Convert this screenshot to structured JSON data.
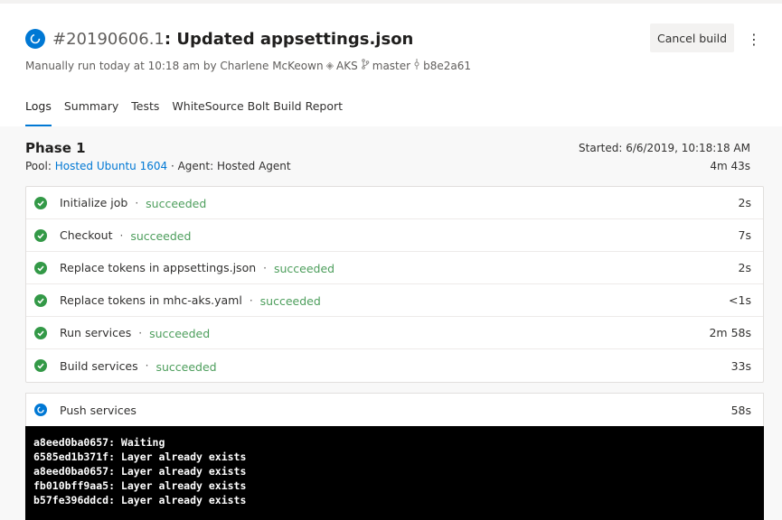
{
  "run": {
    "number": "#20190606.1",
    "title": "Updated appsettings.json",
    "trigger": "Manually run today at 10:18 am by Charlene McKeown",
    "repo": "AKS",
    "branch": "master",
    "commit": "b8e2a61"
  },
  "actions": {
    "cancel_label": "Cancel build",
    "more_label": "⋮"
  },
  "tabs": [
    {
      "label": "Logs",
      "active": true
    },
    {
      "label": "Summary",
      "active": false
    },
    {
      "label": "Tests",
      "active": false
    },
    {
      "label": "WhiteSource Bolt Build Report",
      "active": false
    }
  ],
  "phase": {
    "title": "Phase 1",
    "pool_label": "Pool:",
    "pool": "Hosted Ubuntu 1604",
    "agent_label": "· Agent: Hosted Agent",
    "started": "Started: 6/6/2019, 10:18:18 AM",
    "duration": "4m 43s"
  },
  "steps": [
    {
      "name": "Initialize job",
      "status": "succeeded",
      "time": "2s"
    },
    {
      "name": "Checkout",
      "status": "succeeded",
      "time": "7s"
    },
    {
      "name": "Replace tokens in appsettings.json",
      "status": "succeeded",
      "time": "2s"
    },
    {
      "name": "Replace tokens in mhc-aks.yaml",
      "status": "succeeded",
      "time": "<1s"
    },
    {
      "name": "Run services",
      "status": "succeeded",
      "time": "2m 58s"
    },
    {
      "name": "Build services",
      "status": "succeeded",
      "time": "33s"
    }
  ],
  "running_step": {
    "name": "Push services",
    "time": "58s"
  },
  "console": [
    "a8eed0ba0657: Waiting",
    "6585ed1b371f: Layer already exists",
    "a8eed0ba0657: Layer already exists",
    "fb010bff9aa5: Layer already exists",
    "b57fe396ddcd: Layer already exists"
  ],
  "icons": {
    "run": "in-progress-icon",
    "success": "check-circle-icon",
    "repo": "repo-icon",
    "branch": "branch-icon",
    "commit": "commit-icon"
  },
  "colors": {
    "accent": "#0078d4",
    "success": "#339947",
    "success_text": "#4d9e5c"
  }
}
